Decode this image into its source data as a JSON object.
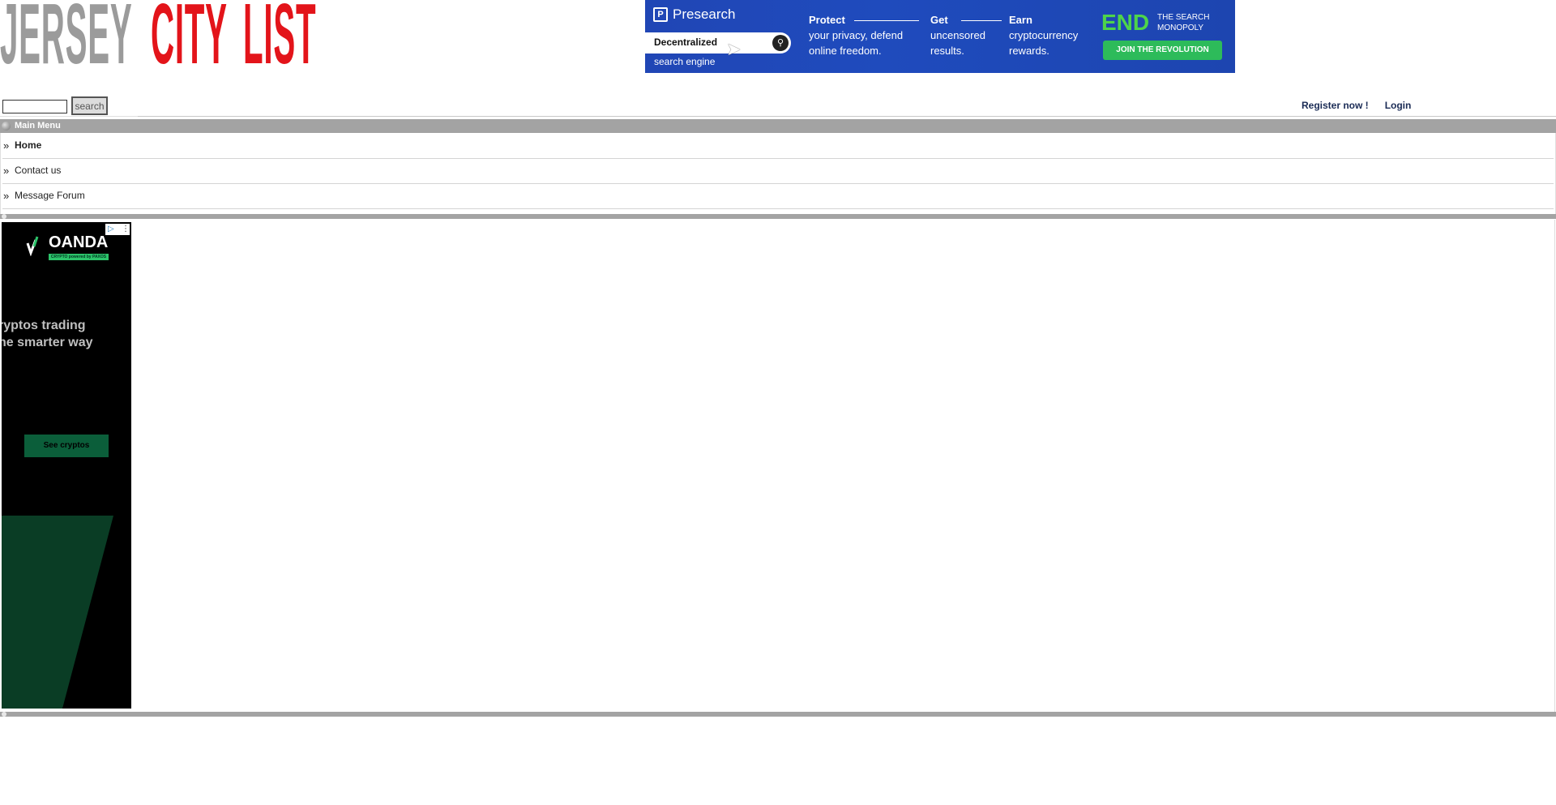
{
  "logo": {
    "word1": "JERSEY",
    "word2": "CITY",
    "word3": "LIST"
  },
  "banner_ad": {
    "brand": "Presearch",
    "brand_icon": "P",
    "search_text": "Decentralized",
    "search_icon": "magnifier-icon",
    "sub_text": "search engine",
    "col1_title": "Protect",
    "col1_body": "your privacy, defend online freedom.",
    "col2_title": "Get",
    "col2_body": "uncensored results.",
    "col3_title": "Earn",
    "col3_body": "cryptocurrency rewards.",
    "end_word": "END",
    "end_sub": "THE SEARCH MONOPOLY",
    "cta": "JOIN THE REVOLUTION",
    "colors": {
      "background": "#1f4bbd",
      "accent": "#4ed44a",
      "cta": "#2dbb5a"
    }
  },
  "search": {
    "value": "",
    "button_label": "search"
  },
  "account": {
    "register": "Register now !",
    "login": "Login"
  },
  "menu": {
    "title": "Main Menu",
    "items": [
      {
        "label": "Home",
        "bold": true
      },
      {
        "label": "Contact us",
        "bold": false
      },
      {
        "label": "Message Forum",
        "bold": false
      }
    ]
  },
  "side_ad": {
    "brand": "OANDA",
    "tagline": "CRYPTO  powered by  PAXOS",
    "headline_line1": "ryptos trading",
    "headline_line2": "he smarter way",
    "cta": "See cryptos",
    "colors": {
      "background": "#000000",
      "accent": "#2cc46a",
      "cta": "#0b5e3a",
      "shape": "#0a3d25"
    }
  },
  "colors": {
    "logo_gray": "#9b9b9b",
    "logo_red": "#e3141a",
    "menu_bar": "#a3a3a3",
    "link": "#1a2b55"
  }
}
